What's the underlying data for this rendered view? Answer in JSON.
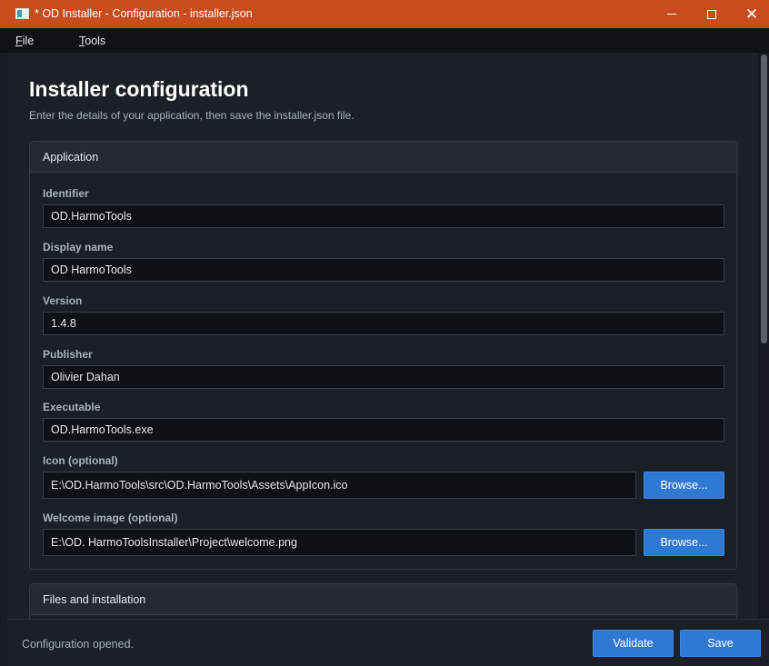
{
  "window": {
    "title": "* OD Installer - Configuration - installer.json",
    "icon": "app-window-icon",
    "close_glyph": "✕"
  },
  "menu": {
    "file": {
      "mnemonic": "F",
      "rest": "ile"
    },
    "tools": {
      "mnemonic": "T",
      "rest": "ools"
    }
  },
  "page": {
    "title": "Installer configuration",
    "subtitle": "Enter the details of your application, then save the installer.json file."
  },
  "application": {
    "header": "Application",
    "fields": {
      "identifier": {
        "label": "Identifier",
        "value": "OD.HarmoTools"
      },
      "display_name": {
        "label": "Display name",
        "value": "OD HarmoTools"
      },
      "version": {
        "label": "Version",
        "value": "1.4.8"
      },
      "publisher": {
        "label": "Publisher",
        "value": "Olivier Dahan"
      },
      "executable": {
        "label": "Executable",
        "value": "OD.HarmoTools.exe"
      },
      "icon": {
        "label": "Icon (optional)",
        "value": "E:\\OD.HarmoTools\\src\\OD.HarmoTools\\Assets\\AppIcon.ico",
        "browse_label": "Browse..."
      },
      "welcome_image": {
        "label": "Welcome image (optional)",
        "value": "E:\\OD. HarmoToolsInstaller\\Project\\welcome.png",
        "browse_label": "Browse..."
      }
    }
  },
  "files_section": {
    "header": "Files and installation"
  },
  "footer": {
    "status": "Configuration opened.",
    "validate_label": "Validate",
    "save_label": "Save"
  },
  "colors": {
    "titlebar": "#c84c1e",
    "accent_button": "#2f79d4",
    "background": "#1c2027"
  }
}
